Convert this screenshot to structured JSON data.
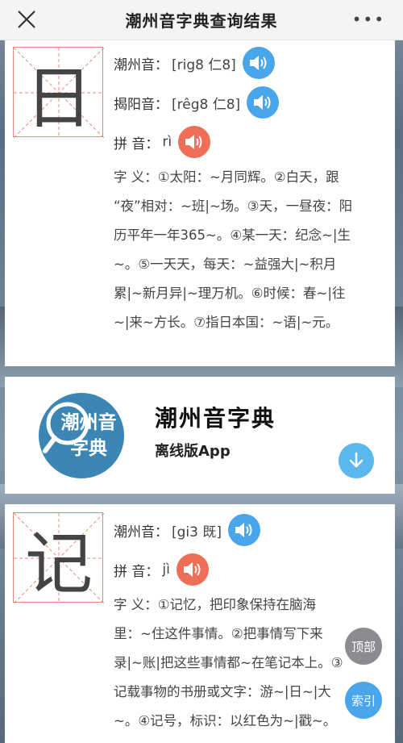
{
  "header": {
    "title": "潮州音字典查询结果",
    "more_label": "•••"
  },
  "entries": [
    {
      "char": "日",
      "rows": [
        {
          "label": "潮州音：",
          "value": "[rig8 仁8]",
          "speaker": "blue"
        },
        {
          "label": "揭阳音：",
          "value": "[rêg8 仁8]",
          "speaker": "blue"
        },
        {
          "label": "拼  音：",
          "value": "rì",
          "speaker": "red"
        }
      ],
      "meaning_label": "字 义：",
      "meaning_lines": [
        "字 义：①太阳：~月同辉。②白天，跟",
        "“夜”相对：~班|~场。③天，一昼夜：阳",
        "历平年一年365~。④某一天：纪念~|生",
        "~。⑤一天天，每天：~益强大|~积月",
        "累|~新月异|~理万机。⑥时候：春~|往",
        "~|来~方长。⑦指日本国：~语|~元。"
      ]
    },
    {
      "char": "记",
      "rows": [
        {
          "label": "潮州音：",
          "value": "[gi3 既]",
          "speaker": "blue"
        },
        {
          "label": "拼  音：",
          "value": "jì",
          "speaker": "red"
        }
      ],
      "meaning_lines": [
        "字 义：①记忆，把印象保持在脑海",
        "里：~住这件事情。②把事情写下来",
        "录|~账|把这些事情都~在笔记本上。③",
        "记载事物的书册或文字：游~|日~|大",
        "~。④记号，标识：以红色为~|戳~。"
      ]
    }
  ],
  "app_banner": {
    "logo_line1": "潮州音",
    "logo_line2": "字典",
    "name": "潮州音字典",
    "subtitle": "离线版App"
  },
  "floating": {
    "top_label": "顶部",
    "index_label": "索引"
  },
  "colors": {
    "speaker_blue": "#4aa6ea",
    "speaker_red": "#ef6e58",
    "grid_red": "#e7887f"
  }
}
